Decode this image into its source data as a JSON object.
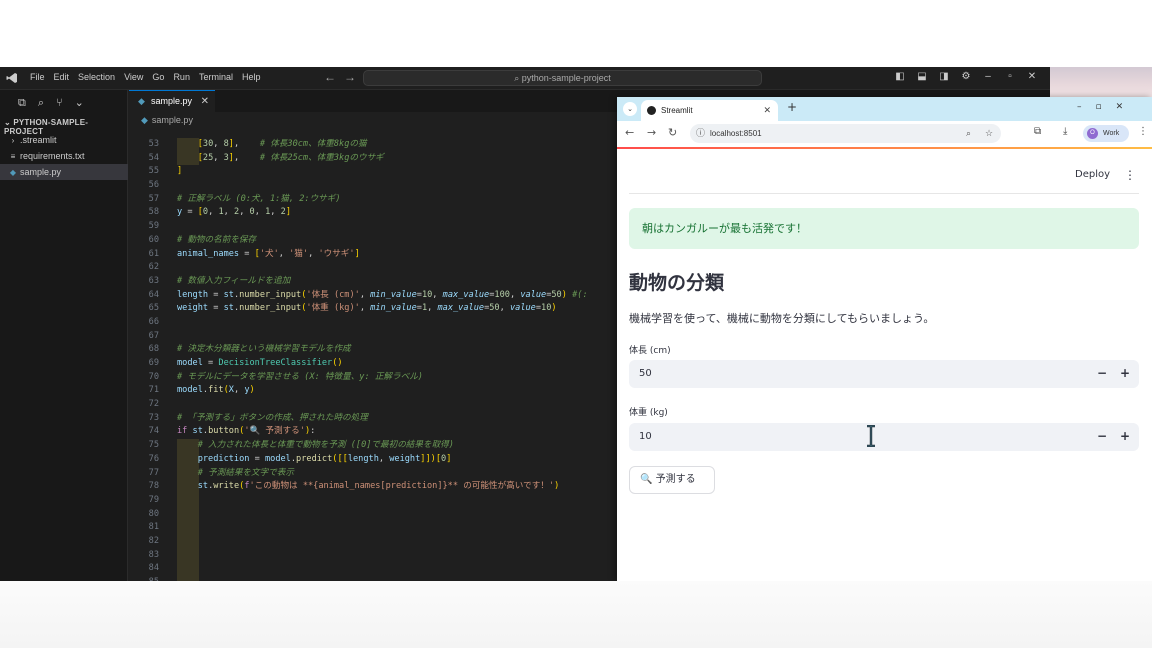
{
  "vscode": {
    "menu": [
      "File",
      "Edit",
      "Selection",
      "View",
      "Go",
      "Run",
      "Terminal",
      "Help"
    ],
    "search_text": "python-sample-project",
    "explorer_header": "PYTHON-SAMPLE-PROJECT",
    "tree": [
      {
        "label": ".streamlit",
        "icon": "chevron-right-icon"
      },
      {
        "label": "requirements.txt",
        "icon": "list-file-icon"
      },
      {
        "label": "sample.py",
        "icon": "python-file-icon"
      }
    ],
    "tab_label": "sample.py",
    "breadcrumb": "sample.py",
    "lines": [
      {
        "n": "53",
        "t": "    [30, 8],    # 体長30cm、体重8kgの猫"
      },
      {
        "n": "54",
        "t": "    [25, 3],    # 体長25cm、体重3kgのウサギ"
      },
      {
        "n": "55",
        "t": "]"
      },
      {
        "n": "56",
        "t": ""
      },
      {
        "n": "57",
        "t": "# 正解ラベル (0:犬, 1:猫, 2:ウサギ)"
      },
      {
        "n": "58",
        "t": "y = [0, 1, 2, 0, 1, 2]"
      },
      {
        "n": "59",
        "t": ""
      },
      {
        "n": "60",
        "t": "# 動物の名前を保存"
      },
      {
        "n": "61",
        "t": "animal_names = ['犬', '猫', 'ウサギ']"
      },
      {
        "n": "62",
        "t": ""
      },
      {
        "n": "63",
        "t": "# 数値入力フィールドを追加"
      },
      {
        "n": "64",
        "t": "length = st.number_input('体長 (cm)', min_value=10, max_value=100, value=50) #(:"
      },
      {
        "n": "65",
        "t": "weight = st.number_input('体重 (kg)', min_value=1, max_value=50, value=10)"
      },
      {
        "n": "66",
        "t": ""
      },
      {
        "n": "67",
        "t": ""
      },
      {
        "n": "68",
        "t": "# 決定木分類器という機械学習モデルを作成"
      },
      {
        "n": "69",
        "t": "model = DecisionTreeClassifier()"
      },
      {
        "n": "70",
        "t": "# モデルにデータを学習させる (X: 特徴量、y: 正解ラベル)"
      },
      {
        "n": "71",
        "t": "model.fit(X, y)"
      },
      {
        "n": "72",
        "t": ""
      },
      {
        "n": "73",
        "t": "# 「予測する」ボタンの作成、押された時の処理"
      },
      {
        "n": "74",
        "t": "if st.button('🔍 予測する'):"
      },
      {
        "n": "75",
        "t": "    # 入力された体長と体重で動物を予測 ([0]で最初の結果を取得)"
      },
      {
        "n": "76",
        "t": "    prediction = model.predict([[length, weight]])[0]"
      },
      {
        "n": "77",
        "t": "    # 予測結果を文字で表示"
      },
      {
        "n": "78",
        "t": "    st.write(f'この動物は **{animal_names[prediction]}** の可能性が高いです！')"
      },
      {
        "n": "79",
        "t": ""
      },
      {
        "n": "80",
        "t": ""
      },
      {
        "n": "81",
        "t": ""
      },
      {
        "n": "82",
        "t": ""
      },
      {
        "n": "83",
        "t": ""
      },
      {
        "n": "84",
        "t": ""
      },
      {
        "n": "85",
        "t": ""
      }
    ]
  },
  "browser": {
    "tab_title": "Streamlit",
    "url": "localhost:8501",
    "profile_initial": "O",
    "profile_label": "Work"
  },
  "app": {
    "deploy_label": "Deploy",
    "alert_text": "朝はカンガルーが最も活発です！",
    "title": "動物の分類",
    "description": "機械学習を使って、機械に動物を分類にしてもらいましょう。",
    "length_label": "体長 (cm)",
    "length_value": "50",
    "weight_label": "体重 (kg)",
    "weight_value": "10",
    "predict_button": "🔍 予測する",
    "minus": "−",
    "plus": "+"
  },
  "colors": {
    "accent": "#0078d4",
    "alert_bg": "#dff6e7",
    "alert_text": "#177233",
    "streamlit_red": "#ff4b4b"
  }
}
